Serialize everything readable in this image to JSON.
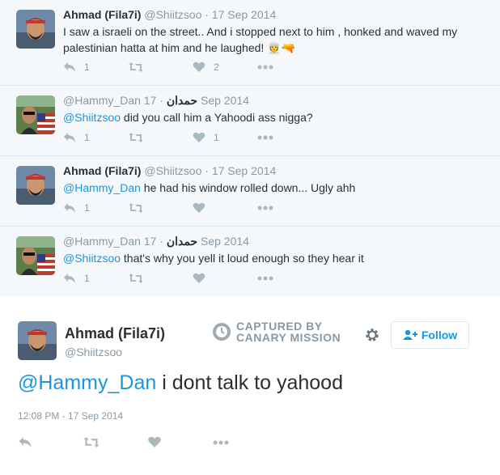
{
  "replies": [
    {
      "name": "Ahmad (Fila7i)",
      "handle": "@Shiitzsoo",
      "date": "17 Sep 2014",
      "mention": "",
      "text": "I saw a israeli on the street.. And i stopped next to him , honked and waved my palestinian hatta at him and he laughed! 👳🔫",
      "reply_count": "1",
      "retweet_count": "",
      "like_count": "2"
    },
    {
      "name": "",
      "handle": "@Hammy_Dan",
      "arabic_name": "حمدان",
      "date": "17 Sep 2014",
      "mention": "@Shiitzsoo",
      "text": " did you call him a Yahoodi ass nigga?",
      "reply_count": "1",
      "retweet_count": "",
      "like_count": "1"
    },
    {
      "name": "Ahmad (Fila7i)",
      "handle": "@Shiitzsoo",
      "date": "17 Sep 2014",
      "mention": "@Hammy_Dan",
      "text": " he had his window rolled down... Ugly ahh",
      "reply_count": "1",
      "retweet_count": "",
      "like_count": ""
    },
    {
      "name": "",
      "handle": "@Hammy_Dan",
      "arabic_name": "حمدان",
      "date": "17 Sep 2014",
      "mention": "@Shiitzsoo",
      "text": " that's why you yell it loud enough so they hear it",
      "reply_count": "1",
      "retweet_count": "",
      "like_count": ""
    }
  ],
  "main_tweet": {
    "name": "Ahmad (Fila7i)",
    "handle": "@Shiitzsoo",
    "mention": "@Hammy_Dan",
    "text": " i dont talk to yahood",
    "timestamp": "12:08 PM - 17 Sep 2014",
    "follow_label": "Follow"
  },
  "watermark": {
    "line1": "CAPTURED BY",
    "line2": "CANARY MISSION"
  },
  "colors": {
    "accent": "#1b95e0",
    "muted": "#8899a6",
    "thread_bg": "#f5f8fa"
  }
}
